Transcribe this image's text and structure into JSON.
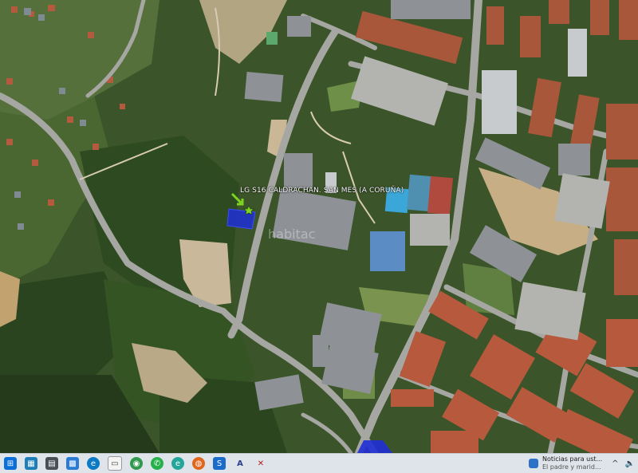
{
  "placemark": {
    "label": "LG S16 CALDRACHAN. SAN MES (A CORUÑA)",
    "icon": "green-star-pin-icon"
  },
  "watermark": {
    "text": "habitac"
  },
  "colors": {
    "vegetation_dark": "#2f4a22",
    "vegetation_mid": "#4b6a33",
    "road": "#9a9c98",
    "roof_red": "#b2563b",
    "roof_grey": "#8d9096",
    "pool_blue": "#3aa7d8",
    "parcel_blue": "#1f2fd6",
    "pin_green": "#7ed321"
  },
  "taskbar": {
    "icons": [
      "start-windows-icon",
      "file-explorer-icon",
      "task-view-icon",
      "photos-icon",
      "edge-icon",
      "document-icon",
      "chrome-icon",
      "whatsapp-icon",
      "edge-beta-icon",
      "firefox-icon",
      "app-s-icon",
      "app-a-icon",
      "app-x-icon"
    ],
    "notification": {
      "title": "Noticias para ust...",
      "body": "El padre y marid..."
    },
    "tray": {
      "chevron": "^",
      "volume": "🔈"
    }
  }
}
